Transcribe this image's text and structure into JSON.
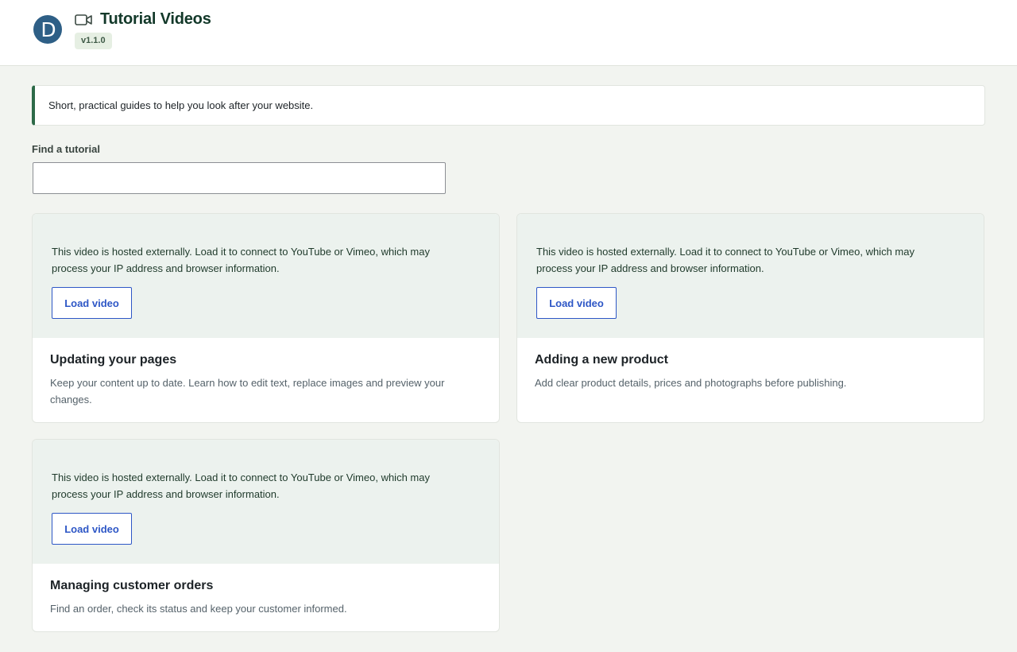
{
  "header": {
    "logo_letter": "D",
    "title": "Tutorial Videos",
    "version": "v1.1.0",
    "icon": "video-camera-icon"
  },
  "intro": {
    "text": "Short, practical guides to help you look after your website."
  },
  "search": {
    "label": "Find a tutorial",
    "value": "",
    "placeholder": ""
  },
  "tutorials": [
    {
      "consent_text": "This video is hosted externally. Load it to connect to YouTube or Vimeo, which may process your IP address and browser information.",
      "button_label": "Load video",
      "title": "Updating your pages",
      "description": "Keep your content up to date. Learn how to edit text, replace images and preview your changes."
    },
    {
      "consent_text": "This video is hosted externally. Load it to connect to YouTube or Vimeo, which may process your IP address and browser information.",
      "button_label": "Load video",
      "title": "Adding a new product",
      "description": "Add clear product details, prices and photographs before publishing."
    },
    {
      "consent_text": "This video is hosted externally. Load it to connect to YouTube or Vimeo, which may process your IP address and browser information.",
      "button_label": "Load video",
      "title": "Managing customer orders",
      "description": "Find an order, check its status and keep your customer informed."
    }
  ],
  "colors": {
    "page_background": "#f2f4f0",
    "accent_green": "#2d6a48",
    "button_blue": "#2e57c6",
    "logo_blue": "#2e5f86"
  }
}
